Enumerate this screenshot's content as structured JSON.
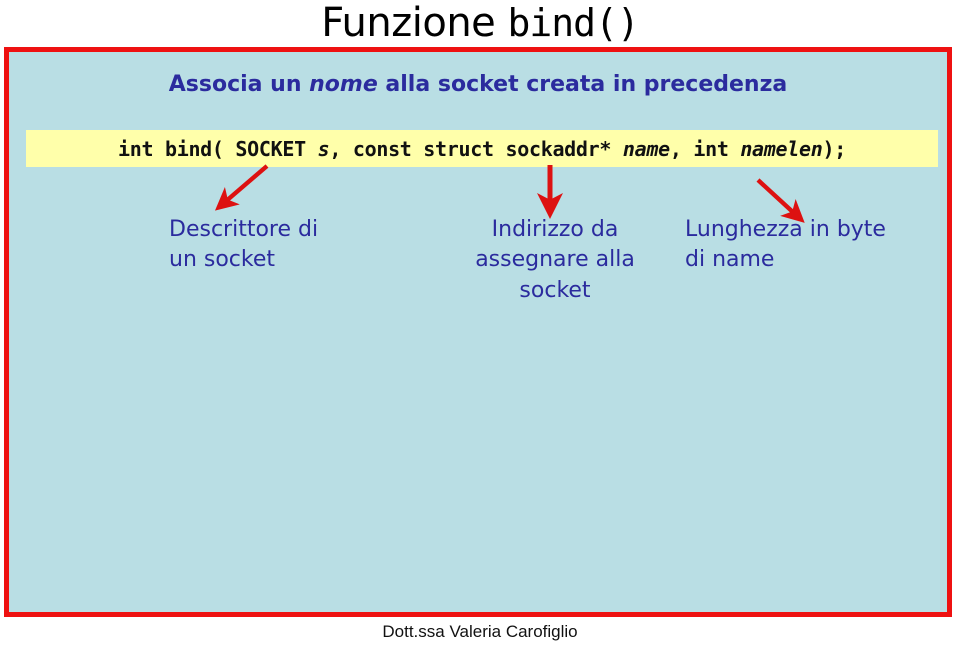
{
  "slide": {
    "title_main": "Funzione ",
    "title_code": "bind()",
    "subtitle_before": "Associa un ",
    "subtitle_italic": "nome",
    "subtitle_after": " alla socket creata in precedenza",
    "code_signature": {
      "part1": "int bind( SOCKET ",
      "param1": "s",
      "part2": ", const struct sockaddr* ",
      "param2": "name",
      "part3": ", int ",
      "param3": "namelen",
      "part4": ");"
    },
    "annotations": [
      {
        "id": "descrittore",
        "text": "Descrittore di\nun socket",
        "arrow": "arrow-down-left"
      },
      {
        "id": "indirizzo",
        "text": "Indirizzo da\nassegnare alla\nsocket",
        "arrow": "arrow-down"
      },
      {
        "id": "lunghezza",
        "text": "Lunghezza in byte\ndi name",
        "arrow": "arrow-down-right"
      }
    ],
    "footer": "Dott.ssa Valeria Carofiglio"
  },
  "colors": {
    "panel_background": "#b9dee4",
    "panel_border": "#ee1111",
    "code_box_background": "#ffffaa",
    "text_blue": "#2b2b9e",
    "arrow_red": "#dd1111",
    "page_background": "#ffffff"
  }
}
